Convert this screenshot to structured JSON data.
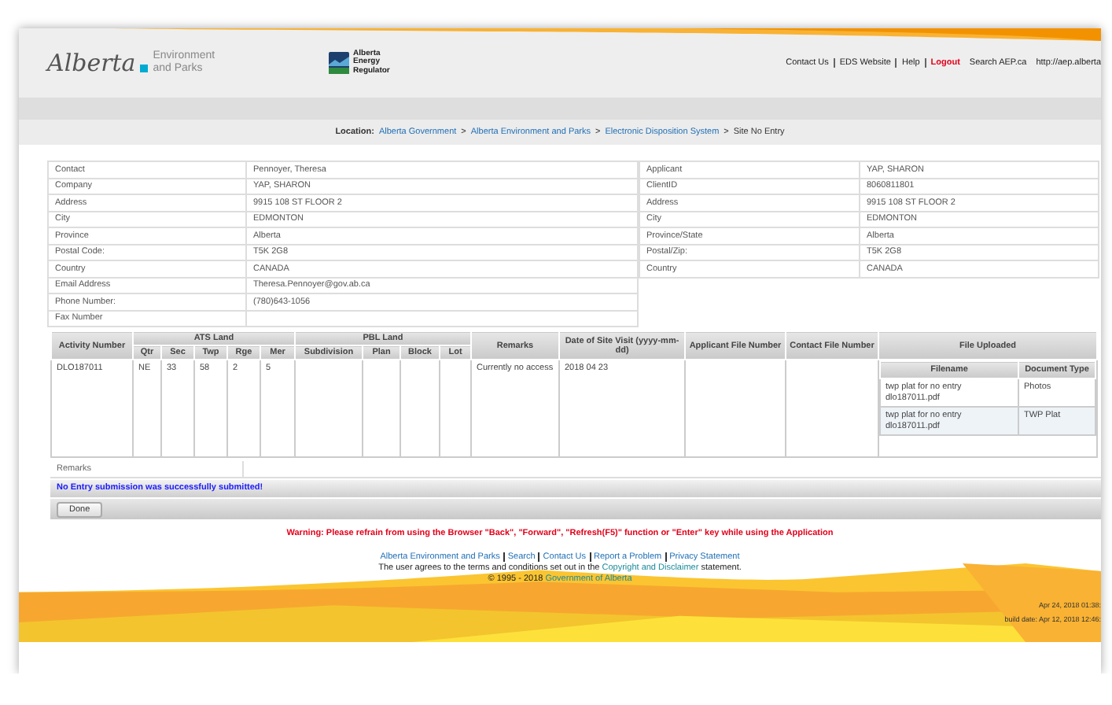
{
  "header": {
    "logo": {
      "wordmark": "Alberta",
      "sub_lines": [
        "Environment",
        "and Parks"
      ]
    },
    "regulator_logo": {
      "lines": [
        "Alberta",
        "Energy",
        "Regulator"
      ]
    },
    "nav": [
      {
        "label": "Contact Us",
        "kind": "link"
      },
      {
        "label": "EDS Website",
        "kind": "link"
      },
      {
        "label": "Help",
        "kind": "link"
      },
      {
        "label": "Logout",
        "kind": "alert"
      }
    ],
    "search": {
      "label": "Search AEP.ca",
      "url": "http://aep.alberta"
    }
  },
  "breadcrumb": {
    "label": "Location:",
    "items": [
      {
        "text": "Alberta Government",
        "kind": "link"
      },
      {
        "text": ">",
        "kind": "sep"
      },
      {
        "text": "Alberta Environment and Parks",
        "kind": "link"
      },
      {
        "text": ">",
        "kind": "sep"
      },
      {
        "text": "Electronic Disposition System",
        "kind": "link"
      },
      {
        "text": ">",
        "kind": "sep"
      },
      {
        "text": "Site No Entry",
        "kind": "current"
      }
    ]
  },
  "contact_info": [
    {
      "label": "Contact",
      "value": "Pennoyer, Theresa"
    },
    {
      "label": "Company",
      "value": "YAP, SHARON"
    },
    {
      "label": "Address",
      "value": "9915 108 ST FLOOR 2"
    },
    {
      "label": "City",
      "value": "EDMONTON"
    },
    {
      "label": "Province",
      "value": "Alberta"
    },
    {
      "label": "Postal Code:",
      "value": "T5K 2G8"
    },
    {
      "label": "Country",
      "value": "CANADA"
    },
    {
      "label": "Email Address",
      "value": "Theresa.Pennoyer@gov.ab.ca"
    },
    {
      "label": "Phone Number:",
      "value": "(780)643-1056"
    },
    {
      "label": "Fax Number"
    }
  ],
  "applicant_info": [
    {
      "label": "Applicant",
      "value": "YAP, SHARON"
    },
    {
      "label": "ClientID",
      "value": "8060811801"
    },
    {
      "label": "Address",
      "value": "9915 108 ST FLOOR 2"
    },
    {
      "label": "City",
      "value": "EDMONTON"
    },
    {
      "label": "Province/State",
      "value": "Alberta"
    },
    {
      "label": "Postal/Zip:",
      "value": "T5K 2G8"
    },
    {
      "label": "Country",
      "value": "CANADA"
    }
  ],
  "entry_table": {
    "groups": [
      "ATS Land",
      "PBL Land"
    ],
    "columns": [
      "Activity Number",
      "Qtr",
      "Sec",
      "Twp",
      "Rge",
      "Mer",
      "Subdivision",
      "Plan",
      "Block",
      "Lot",
      "Remarks",
      "Date of Site Visit (yyyy-mm-dd)",
      "Applicant File Number",
      "Contact File Number",
      "File Uploaded"
    ],
    "file_columns": [
      "Filename",
      "Document Type"
    ],
    "rows": [
      {
        "cells": [
          "DLO187011",
          "NE",
          "33",
          "58",
          "2",
          "5",
          null,
          null,
          null,
          null,
          "Currently no access",
          "2018 04 23",
          null,
          null
        ],
        "files": [
          {
            "filename": "twp plat for no entry dlo187011.pdf",
            "type": "Photos"
          },
          {
            "filename": "twp plat for no entry dlo187011.pdf",
            "type": "TWP Plat"
          }
        ]
      }
    ]
  },
  "remarks": {
    "label": "Remarks"
  },
  "message": "No Entry submission was successfully submitted!",
  "buttons": [
    "Done"
  ],
  "footer": {
    "warning": "Warning: Please refrain from using the Browser \"Back\", \"Forward\", \"Refresh(F5)\" function or \"Enter\" key while using the Application",
    "links": [
      "Alberta Environment and Parks",
      "Search",
      "Contact Us",
      "Report a Problem",
      "Privacy Statement"
    ],
    "terms": {
      "before": "The user agrees to the terms and conditions set out in the",
      "link": "Copyright and Disclaimer",
      "after": "statement."
    },
    "copyright": {
      "text": "© 1995 - 2018",
      "link": "Government of Alberta"
    },
    "timestamps": [
      "Apr 24, 2018 01:38:",
      "build date: Apr 12, 2018 12:46:"
    ]
  }
}
